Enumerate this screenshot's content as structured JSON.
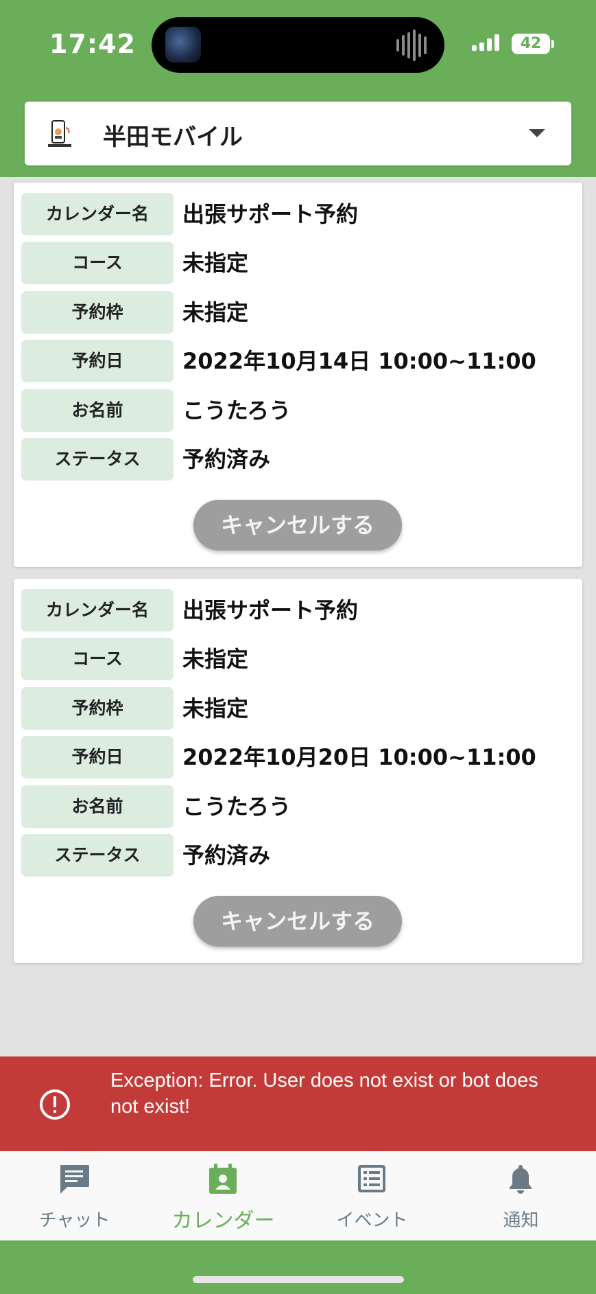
{
  "status_bar": {
    "time": "17:42",
    "battery": "42"
  },
  "header": {
    "account_name": "半田モバイル"
  },
  "reservations": [
    {
      "rows": [
        {
          "label": "カレンダー名",
          "value": "出張サポート予約"
        },
        {
          "label": "コース",
          "value": "未指定"
        },
        {
          "label": "予約枠",
          "value": "未指定"
        },
        {
          "label": "予約日",
          "value": "2022年10月14日 10:00~11:00"
        },
        {
          "label": "お名前",
          "value": "こうたろう"
        },
        {
          "label": "ステータス",
          "value": "予約済み"
        }
      ],
      "cancel_label": "キャンセルする"
    },
    {
      "rows": [
        {
          "label": "カレンダー名",
          "value": "出張サポート予約"
        },
        {
          "label": "コース",
          "value": "未指定"
        },
        {
          "label": "予約枠",
          "value": "未指定"
        },
        {
          "label": "予約日",
          "value": "2022年10月20日 10:00~11:00"
        },
        {
          "label": "お名前",
          "value": "こうたろう"
        },
        {
          "label": "ステータス",
          "value": "予約済み"
        }
      ],
      "cancel_label": "キャンセルする"
    }
  ],
  "error": {
    "message": "Exception: Error. User does not exist or bot does not exist!"
  },
  "bottom_nav": {
    "items": [
      {
        "label": "チャット",
        "icon": "chat-icon",
        "active": false
      },
      {
        "label": "カレンダー",
        "icon": "calendar-icon",
        "active": true
      },
      {
        "label": "イベント",
        "icon": "list-icon",
        "active": false
      },
      {
        "label": "通知",
        "icon": "bell-icon",
        "active": false
      }
    ]
  },
  "colors": {
    "brand_green": "#6aae5a",
    "error_red": "#c33b38",
    "label_bg": "#dcede0",
    "button_gray": "#9e9e9e",
    "nav_icon": "#6a7a86"
  }
}
